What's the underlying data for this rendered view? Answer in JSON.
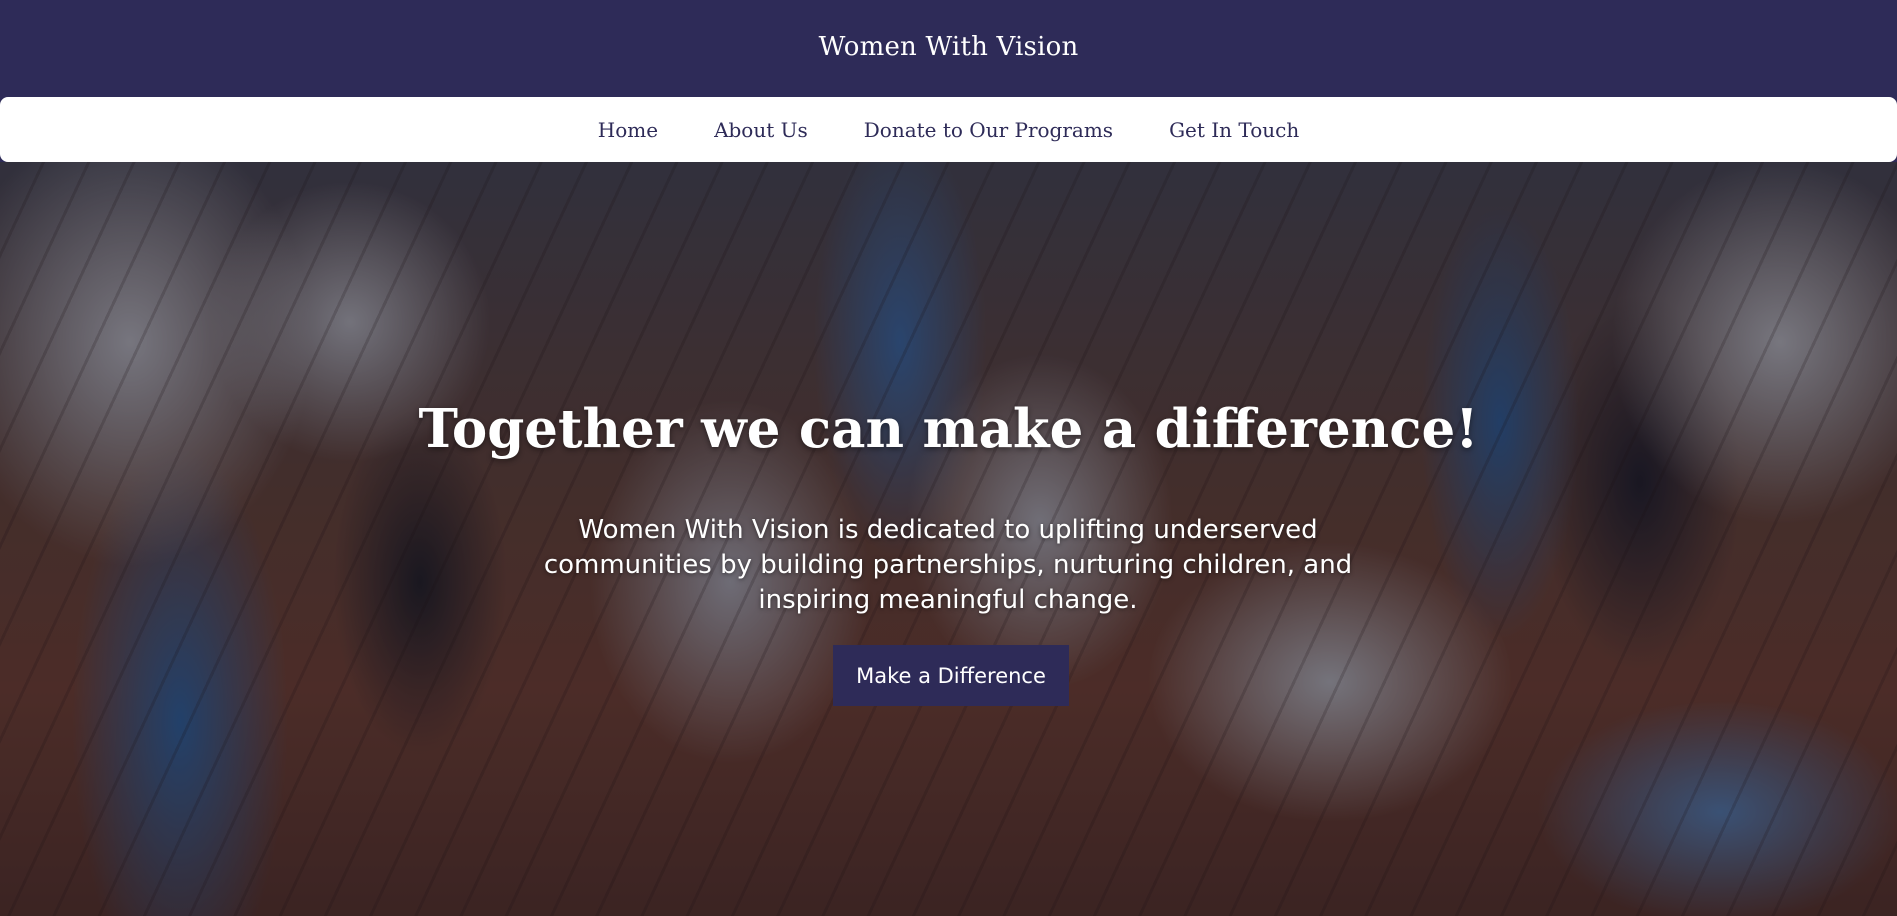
{
  "header": {
    "site_title": "Women With Vision"
  },
  "nav": {
    "items": [
      {
        "label": "Home"
      },
      {
        "label": "About Us"
      },
      {
        "label": "Donate to Our Programs"
      },
      {
        "label": "Get In Touch"
      }
    ]
  },
  "hero": {
    "title": "Together we can make a difference!",
    "description": "Women With Vision is dedicated to uplifting underserved communities by building partnerships, nurturing children, and inspiring meaningful change.",
    "cta_label": "Make a Difference"
  },
  "colors": {
    "brand_primary": "#2e2b58",
    "nav_background": "#ffffff",
    "text_light": "#ffffff"
  }
}
